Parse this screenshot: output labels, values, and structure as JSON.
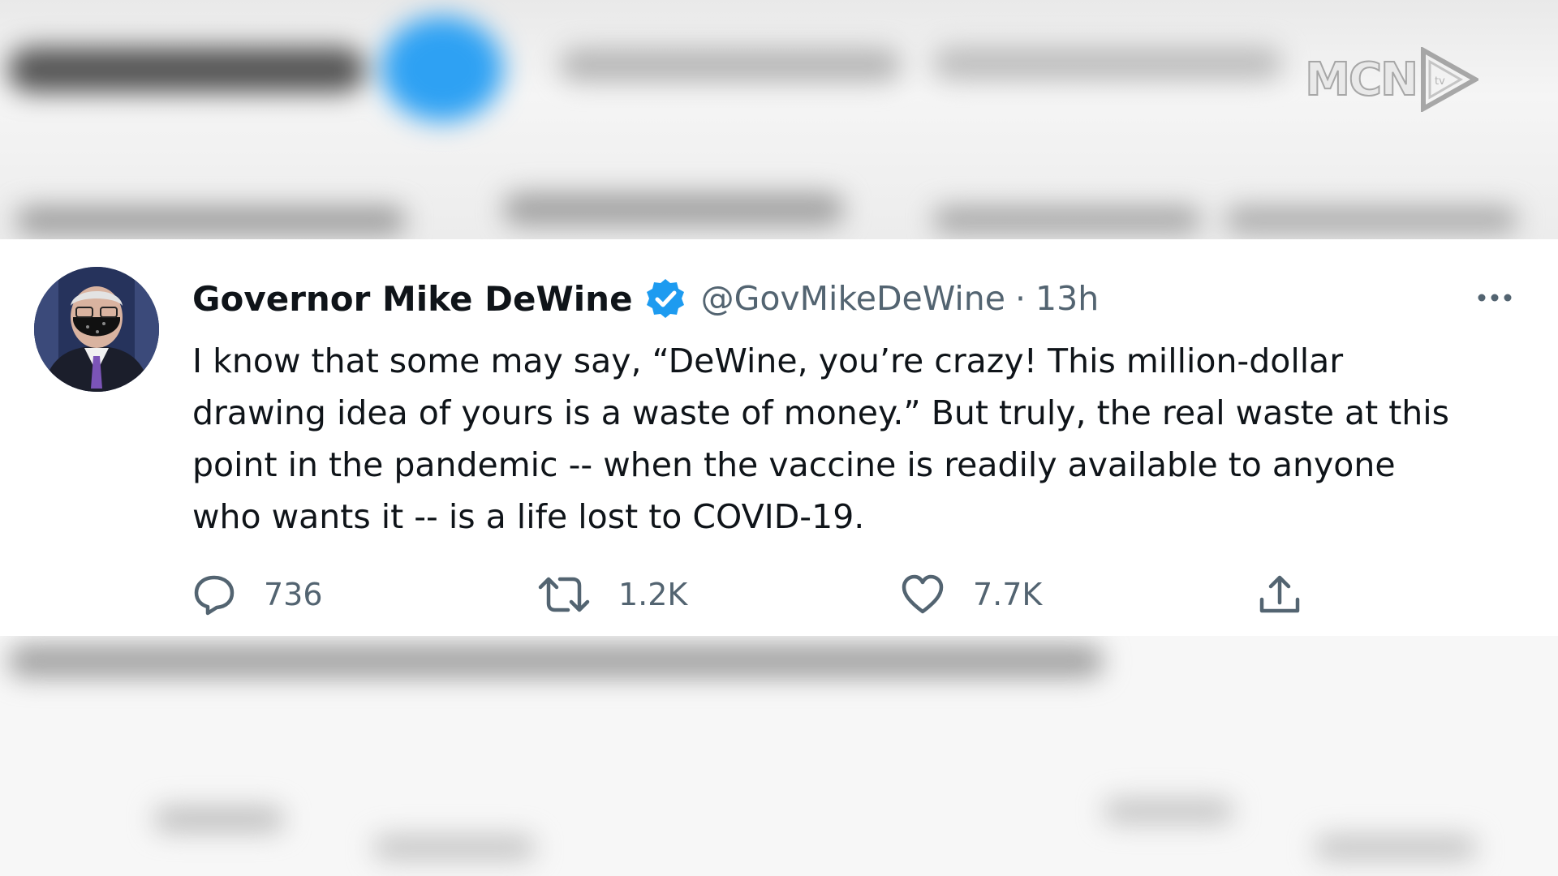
{
  "watermark": {
    "text": "MCN",
    "sub": "tv"
  },
  "tweet": {
    "author_name": "Governor Mike DeWine",
    "handle": "@GovMikeDeWine",
    "separator": "·",
    "time": "13h",
    "text": "I know that some may say, “DeWine, you’re crazy!  This million-dollar\ndrawing idea of yours is a waste of money.”  But truly, the real waste at this\npoint in the pandemic -- when the vaccine is readily available to anyone\nwho wants it -- is a life lost to COVID-19.",
    "actions": {
      "reply_count": "736",
      "retweet_count": "1.2K",
      "like_count": "7.7K"
    },
    "icons": {
      "verified": "verified-badge-icon",
      "more": "more-icon",
      "reply": "reply-icon",
      "retweet": "retweet-icon",
      "like": "heart-icon",
      "share": "share-icon"
    }
  },
  "colors": {
    "verified": "#1d9bf0",
    "text_primary": "#0f1419",
    "text_secondary": "#536471"
  }
}
